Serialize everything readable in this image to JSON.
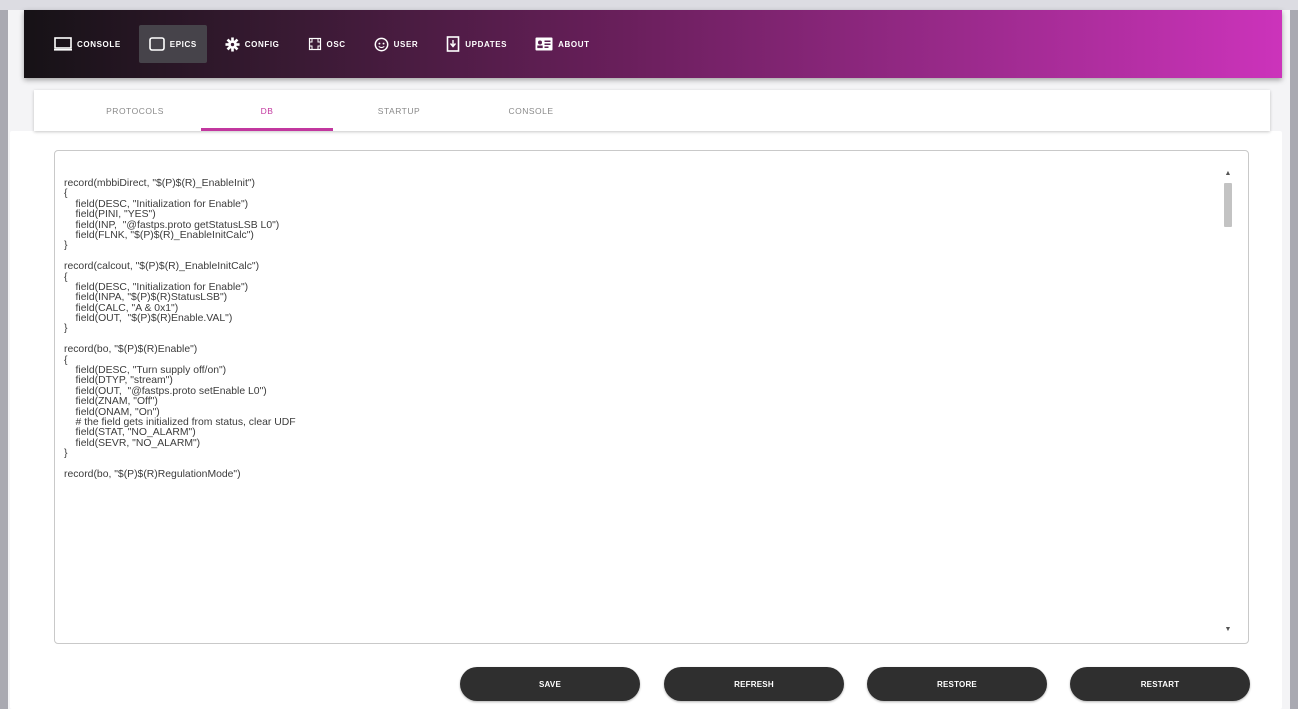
{
  "navbar": {
    "items": [
      {
        "label": "CONSOLE",
        "icon": "monitor-icon"
      },
      {
        "label": "EPICS",
        "icon": "square-icon"
      },
      {
        "label": "CONFIG",
        "icon": "gear-icon"
      },
      {
        "label": "OSC",
        "icon": "oscilloscope-icon"
      },
      {
        "label": "USER",
        "icon": "user-icon"
      },
      {
        "label": "UPDATES",
        "icon": "download-icon"
      },
      {
        "label": "ABOUT",
        "icon": "id-card-icon"
      }
    ],
    "active": "EPICS",
    "gradient_colors": [
      "#161216",
      "#6a1f5c",
      "#cc33bb"
    ]
  },
  "tabs": {
    "items": [
      "PROTOCOLS",
      "DB",
      "STARTUP",
      "CONSOLE"
    ],
    "active": "DB",
    "accent_color": "#c2379f"
  },
  "editor": {
    "lines": [
      "record(mbbiDirect, \"$(P)$(R)_EnableInit\")",
      "{",
      "    field(DESC, \"Initialization for Enable\")",
      "    field(PINI, \"YES\")",
      "    field(INP,  \"@fastps.proto getStatusLSB L0\")",
      "    field(FLNK, \"$(P)$(R)_EnableInitCalc\")",
      "}",
      "",
      "record(calcout, \"$(P)$(R)_EnableInitCalc\")",
      "{",
      "    field(DESC, \"Initialization for Enable\")",
      "    field(INPA, \"$(P)$(R)StatusLSB\")",
      "    field(CALC, \"A & 0x1\")",
      "    field(OUT,  \"$(P)$(R)Enable.VAL\")",
      "}",
      "",
      "record(bo, \"$(P)$(R)Enable\")",
      "{",
      "    field(DESC, \"Turn supply off/on\")",
      "    field(DTYP, \"stream\")",
      "    field(OUT,  \"@fastps.proto setEnable L0\")",
      "    field(ZNAM, \"Off\")",
      "    field(ONAM, \"On\")",
      "    # the field gets initialized from status, clear UDF",
      "    field(STAT, \"NO_ALARM\")",
      "    field(SEVR, \"NO_ALARM\")",
      "}",
      "",
      "record(bo, \"$(P)$(R)RegulationMode\")"
    ]
  },
  "actions": {
    "save_label": "SAVE",
    "refresh_label": "REFRESH",
    "restore_label": "RESTORE",
    "restart_label": "RESTART",
    "button_color": "#2f2f2f"
  }
}
